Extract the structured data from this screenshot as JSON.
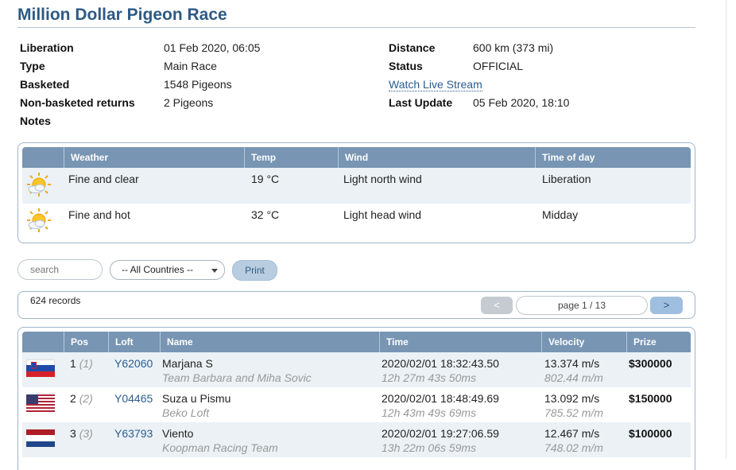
{
  "page": {
    "title": "Million Dollar Pigeon Race"
  },
  "info_left": [
    {
      "label": "Liberation",
      "value": "01 Feb 2020, 06:05"
    },
    {
      "label": "Type",
      "value": "Main Race"
    },
    {
      "label": "Basketed",
      "value": "1548 Pigeons"
    },
    {
      "label": "Non-basketed returns",
      "value": "2 Pigeons"
    },
    {
      "label": "Notes",
      "value": ""
    }
  ],
  "info_right": {
    "distance_label": "Distance",
    "distance_value": "600 km (373 mi)",
    "status_label": "Status",
    "status_value": "OFFICIAL",
    "stream_link": "Watch Live Stream",
    "update_label": "Last Update",
    "update_value": "05 Feb 2020, 18:10"
  },
  "weather": {
    "headers": [
      "Weather",
      "Temp",
      "Wind",
      "Time of day"
    ],
    "rows": [
      {
        "icon": "sun-cloud-icon",
        "weather": "Fine and clear",
        "temp": "19 °C",
        "wind": "Light north wind",
        "time": "Liberation"
      },
      {
        "icon": "sun-cloud-icon",
        "weather": "Fine and hot",
        "temp": "32 °C",
        "wind": "Light head wind",
        "time": "Midday"
      }
    ]
  },
  "controls": {
    "search_placeholder": "search",
    "country_selected": "-- All Countries --",
    "print_label": "Print"
  },
  "pager": {
    "records": "624 records",
    "prev": "<",
    "page_text": "page 1 / 13",
    "next": ">"
  },
  "results": {
    "headers": [
      "Pos",
      "Loft",
      "Name",
      "Time",
      "Velocity",
      "Prize"
    ],
    "rows": [
      {
        "flag": "slovenia",
        "pos": "1",
        "pos_sub": "(1)",
        "loft": "Y62060",
        "name": "Marjana S",
        "team": "Team Barbara and Miha Sovic",
        "time": "2020/02/01 18:32:43.50",
        "duration": "12h 27m 43s 50ms",
        "velocity": "13.374 m/s",
        "velocity_mm": "802.44 m/m",
        "prize": "$300000"
      },
      {
        "flag": "usa",
        "pos": "2",
        "pos_sub": "(2)",
        "loft": "Y04465",
        "name": "Suza u Pismu",
        "team": "Beko Loft",
        "time": "2020/02/01 18:48:49.69",
        "duration": "12h 43m 49s 69ms",
        "velocity": "13.092 m/s",
        "velocity_mm": "785.52 m/m",
        "prize": "$150000"
      },
      {
        "flag": "netherlands",
        "pos": "3",
        "pos_sub": "(3)",
        "loft": "Y63793",
        "name": "Viento",
        "team": "Koopman Racing Team",
        "time": "2020/02/01 19:27:06.59",
        "duration": "13h 22m 06s 59ms",
        "velocity": "12.467 m/s",
        "velocity_mm": "748.02 m/m",
        "prize": "$100000"
      }
    ]
  },
  "colors": {
    "title": "#2e5a84",
    "header_bar": "#7895b3",
    "row_alt": "#ebf1f5",
    "link": "#2a5d8e"
  }
}
